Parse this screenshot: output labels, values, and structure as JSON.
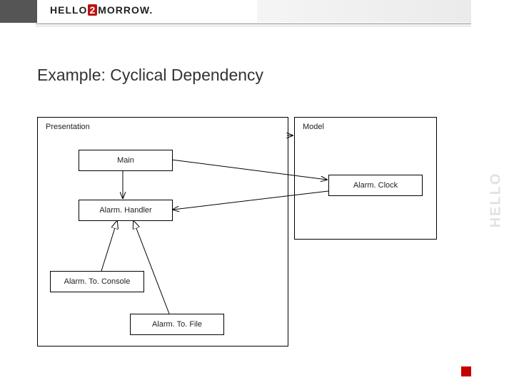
{
  "brand": {
    "part1": "HELLO",
    "mid": "2",
    "part2": "MORROW",
    "suffix": "."
  },
  "title": "Example: Cyclical Dependency",
  "diagram": {
    "packages": {
      "left": "Presentation",
      "right": "Model"
    },
    "nodes": {
      "main": "Main",
      "handler": "Alarm. Handler",
      "clock": "Alarm. Clock",
      "console": "Alarm. To. Console",
      "file": "Alarm. To. File"
    }
  }
}
